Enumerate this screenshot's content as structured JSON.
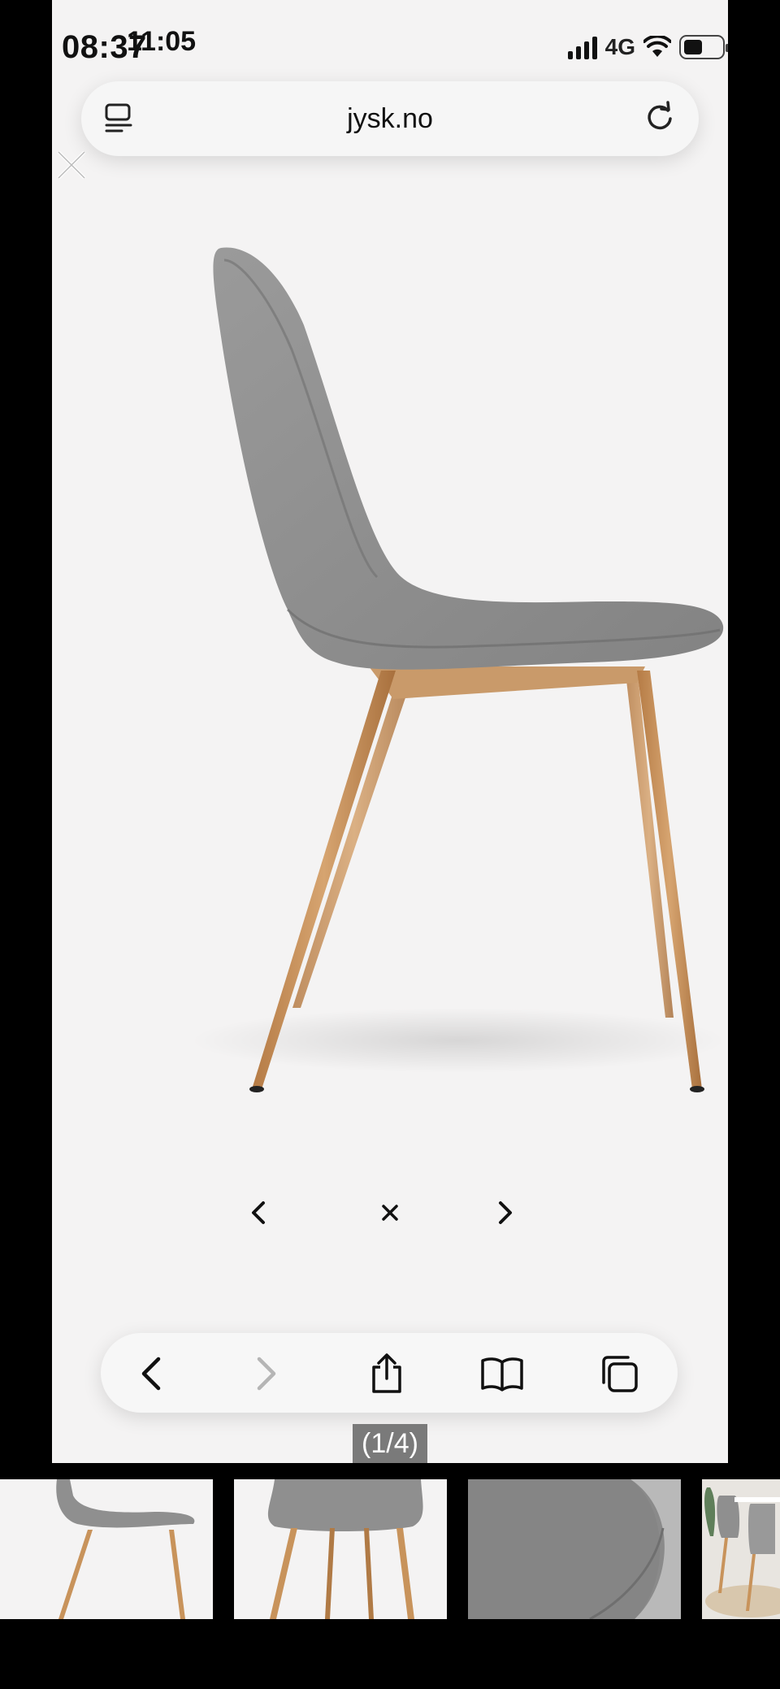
{
  "status_bar": {
    "time": "08:37",
    "overlay_time": "11:05",
    "network": "4G"
  },
  "browser": {
    "domain": "jysk.no"
  },
  "icons": {
    "tab_overview": "tab-overview-icon",
    "reload": "reload-icon",
    "close": "close-icon",
    "back": "back-icon",
    "forward": "forward-icon",
    "share": "share-icon",
    "bookmarks": "bookmarks-icon",
    "tabs": "tabs-icon"
  },
  "gallery": {
    "counter": "(1/4)",
    "current_index": 1,
    "total": 4,
    "controls": {
      "prev": "‹",
      "close": "×",
      "next": "›"
    },
    "thumbnails": [
      "chair-side-view",
      "chair-front-view",
      "fabric-detail",
      "dining-room-scene"
    ]
  },
  "colors": {
    "chair_fabric": "#8f8f8f",
    "chair_legs": "#c8935b",
    "background": "#f4f3f3"
  }
}
